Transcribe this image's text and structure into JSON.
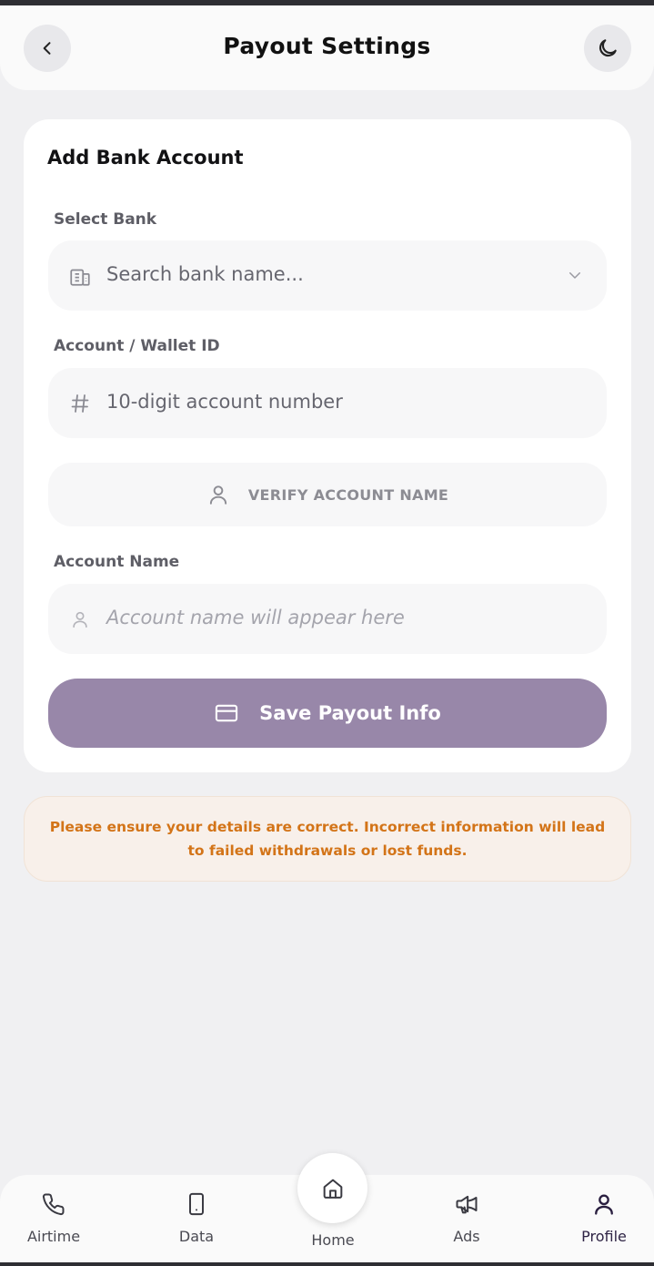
{
  "header": {
    "title": "Payout Settings",
    "back_icon": "chevron-left-icon",
    "theme_icon": "moon-icon"
  },
  "card": {
    "title": "Add Bank Account",
    "bank": {
      "label": "Select Bank",
      "placeholder": "Search bank name...",
      "icon": "building-icon",
      "dropdown_icon": "chevron-down-icon"
    },
    "account": {
      "label": "Account / Wallet ID",
      "placeholder": "10-digit account number",
      "icon": "hash-icon"
    },
    "verify": {
      "label": "VERIFY ACCOUNT NAME",
      "icon": "user-icon"
    },
    "account_name": {
      "label": "Account Name",
      "placeholder": "Account name will appear here",
      "icon": "user-icon"
    },
    "save": {
      "label": "Save Payout Info",
      "icon": "credit-card-icon"
    }
  },
  "warning": {
    "text": "Please ensure your details are correct. Incorrect information will lead to failed withdrawals or lost funds."
  },
  "nav": {
    "items": [
      {
        "label": "Airtime",
        "icon": "phone-icon"
      },
      {
        "label": "Data",
        "icon": "smartphone-icon"
      },
      {
        "label": "Home",
        "icon": "home-icon"
      },
      {
        "label": "Ads",
        "icon": "megaphone-icon"
      },
      {
        "label": "Profile",
        "icon": "user-icon"
      }
    ],
    "active": "Profile"
  },
  "colors": {
    "background": "#f0f0f2",
    "primary_button": "#9887a9",
    "warning_text": "#d37418",
    "warning_bg": "#f8f0ea"
  }
}
